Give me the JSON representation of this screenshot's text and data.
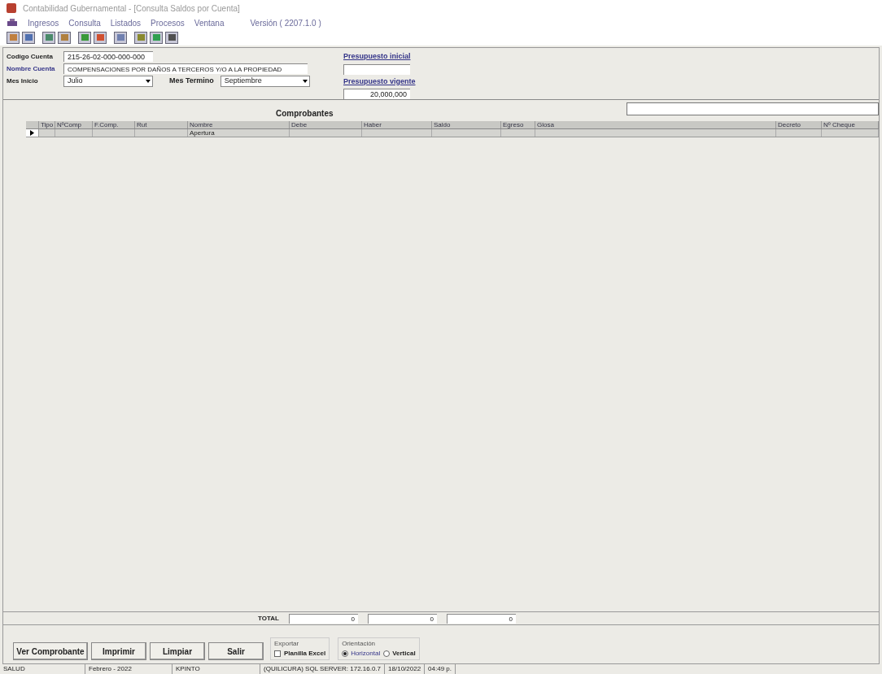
{
  "window": {
    "title": "Contabilidad Gubernamental - [Consulta Saldos por Cuenta]"
  },
  "menu": [
    "Ingresos",
    "Consulta",
    "Listados",
    "Procesos",
    "Ventana"
  ],
  "version": "Versión ( 2207.1.0 )",
  "form": {
    "codigo_label": "Codigo Cuenta",
    "codigo": "215-26-02-000-000-000",
    "nombre_label": "Nombre Cuenta",
    "nombre": "COMPENSACIONES POR DAÑOS A TERCEROS Y/O A LA PROPIEDAD",
    "mes_inicio_label": "Mes Inicio",
    "mes_inicio": "Julio",
    "mes_termino_label": "Mes Termino",
    "mes_termino": "Septiembre",
    "presupuesto_inicial_label": "Presupuesto inicial",
    "presupuesto_vigente_label": "Presupuesto vigente",
    "presupuesto_vigente": "20,000,000"
  },
  "section_title": "Comprobantes",
  "table": {
    "columns": [
      "Tipo",
      "NºComp",
      "F.Comp.",
      "Rut",
      "Nombre",
      "Debe",
      "Haber",
      "Saldo",
      "Egreso",
      "Glosa",
      "Decreto",
      "Nº Cheque"
    ],
    "rows": [
      {
        "selected": true,
        "nombre": "Apertura"
      }
    ]
  },
  "totals": {
    "label": "TOTAL",
    "values": [
      "0",
      "0",
      "0"
    ]
  },
  "buttons": [
    "Ver Comprobante",
    "Imprimir",
    "Limpiar",
    "Salir"
  ],
  "exportar": {
    "title": "Exportar",
    "label": "Planilla Excel",
    "checked": false
  },
  "orientacion": {
    "title": "Orientación",
    "options": [
      {
        "label": "Horizontal",
        "selected": true
      },
      {
        "label": "Vertical",
        "selected": false
      }
    ]
  },
  "status_bar": [
    "SALUD",
    "Febrero - 2022",
    "KPINTO",
    "(QUILICURA) SQL SERVER: 172.16.0.7",
    "18/10/2022",
    "04:49 p."
  ]
}
